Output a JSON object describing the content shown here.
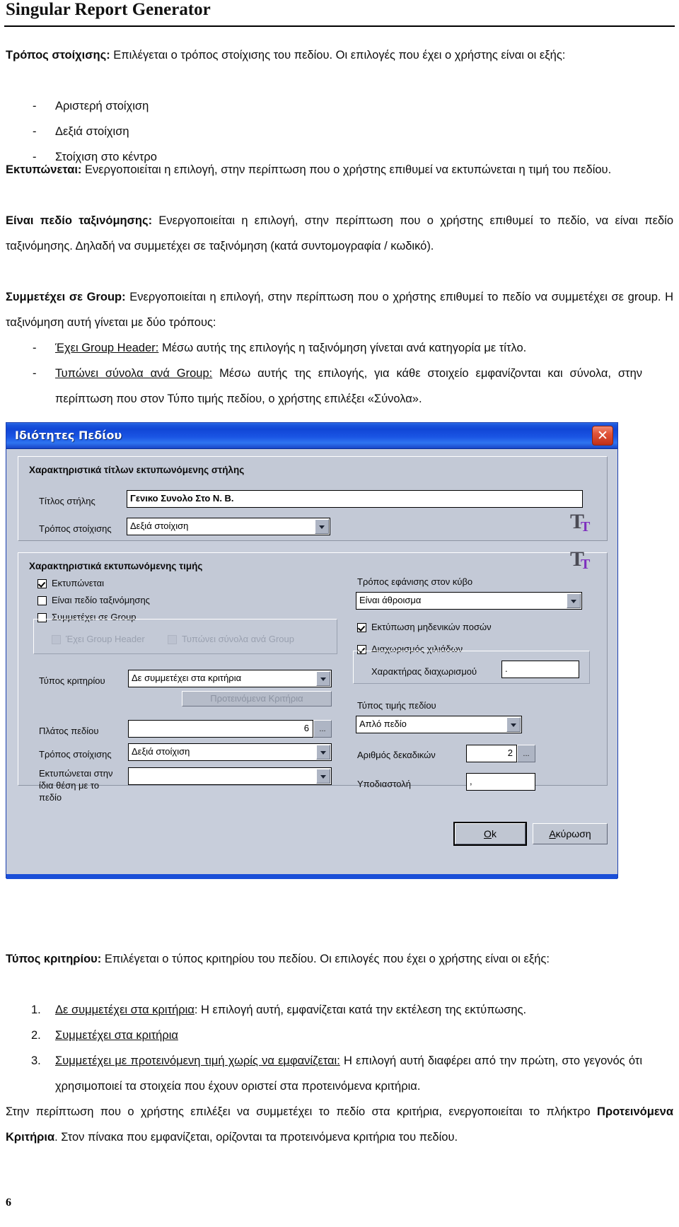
{
  "header": {
    "title": "Singular Report Generator"
  },
  "page_number": "6",
  "content": {
    "para_alignment": {
      "bold_lead": "Τρόπος στοίχισης:",
      "rest": " Επιλέγεται ο τρόπος στοίχισης του πεδίου. Οι επιλογές που έχει ο χρήστης είναι οι εξής:"
    },
    "alignment_options": [
      "Αριστερή στοίχιση",
      "Δεξιά στοίχιση",
      "Στοίχιση στο κέντρο"
    ],
    "para_print": {
      "bold_lead": "Εκτυπώνεται:",
      "rest": " Ενεργοποιείται η επιλογή, στην περίπτωση που ο χρήστης επιθυμεί να εκτυπώνεται η τιμή του πεδίου."
    },
    "para_sortfield": {
      "bold_lead": "Είναι πεδίο ταξινόμησης:",
      "rest": " Ενεργοποιείται η επιλογή, στην περίπτωση που ο χρήστης επιθυμεί το πεδίο, να είναι πεδίο ταξινόμησης. Δηλαδή να συμμετέχει σε ταξινόμηση (κατά συντομογραφία / κωδικό)."
    },
    "para_group": {
      "bold_lead": "Συμμετέχει σε Group:",
      "rest": " Ενεργοποιείται η επιλογή, στην περίπτωση που ο χρήστης επιθυμεί το πεδίο να συμμετέχει σε group. Η ταξινόμηση αυτή γίνεται με δύο τρόπους:"
    },
    "group_options": [
      {
        "underlined": "Έχει Group Header:",
        "rest": " Μέσω αυτής της επιλογής η ταξινόμηση γίνεται ανά κατηγορία με τίτλο."
      },
      {
        "underlined": "Τυπώνει σύνολα ανά Group:",
        "rest": " Μέσω αυτής της επιλογής, για κάθε στοιχείο εμφανίζονται και σύνολα, στην περίπτωση που στον Τύπο τιμής πεδίου, ο χρήστης επιλέξει «Σύνολα»."
      }
    ],
    "para_criteria": {
      "bold_lead": "Τύπος κριτηρίου:",
      "rest": " Επιλέγεται ο τύπος κριτηρίου του πεδίου. Οι επιλογές που έχει ο χρήστης είναι οι εξής:"
    },
    "criteria_items": [
      {
        "num": "1.",
        "underlined": "Δε συμμετέχει στα κριτήρια",
        "rest": ": Η επιλογή αυτή, εμφανίζεται κατά την εκτέλεση της εκτύπωσης."
      },
      {
        "num": "2.",
        "underlined": "Συμμετέχει στα κριτήρια",
        "rest": ""
      },
      {
        "num": "3.",
        "underlined": "Συμμετέχει με προτεινόμενη τιμή χωρίς να εμφανίζεται:",
        "rest": " Η επιλογή αυτή διαφέρει από την πρώτη, στο γεγονός ότι χρησιμοποιεί τα στοιχεία που έχουν οριστεί στα προτεινόμενα κριτήρια."
      }
    ],
    "para_closing": {
      "part1": "Στην περίπτωση που ο χρήστης επιλέξει να συμμετέχει το πεδίο στα κριτήρια, ενεργοποιείται το πλήκτρο ",
      "bold": "Προτεινόμενα Κριτήρια",
      "part2": ". Στον πίνακα που εμφανίζεται, ορίζονται τα προτεινόμενα κριτήρια του πεδίου."
    }
  },
  "dialog": {
    "title": "Ιδιότητες Πεδίου",
    "close_label": "✕",
    "group_title_header": "Χαρακτηριστικά τίτλων εκτυπωνόμενης στήλης",
    "group_value_header": "Χαρακτηριστικά εκτυπωνόμενης τιμής",
    "fields": {
      "column_title_label": "Τίτλος στήλης",
      "column_title_value": "Γενικο Συνολο Στο Ν. Β.",
      "title_align_label": "Τρόπος στοίχισης",
      "title_align_value": "Δεξιά στοίχιση",
      "print_checkbox": "Εκτυπώνεται",
      "is_sort_checkbox": "Είναι πεδίο ταξινόμησης",
      "in_group_checkbox": "Συμμετέχει σε Group",
      "has_group_header_checkbox": "Έχει Group Header",
      "prints_totals_checkbox": "Τυπώνει σύνολα ανά Group",
      "criteria_type_label": "Τύπος κριτηρίου",
      "criteria_type_value": "Δε συμμετέχει στα κριτήρια",
      "suggested_criteria_button": "Προτεινόμενα Κριτήρια",
      "field_width_label": "Πλάτος πεδίου",
      "field_width_value": "6",
      "value_align_label": "Τρόπος στοίχισης",
      "value_align_value": "Δεξιά στοίχιση",
      "same_position_label": "Εκτυπώνεται στην ίδια θέση με το πεδίο",
      "same_position_value": "",
      "cube_display_label": "Τρόπος εφάνισης στον κύβο",
      "cube_display_value": "Είναι άθροισμα",
      "print_zero_checkbox": "Εκτύπωση μηδενικών ποσών",
      "thousands_sep_checkbox": "Διαχωρισμός χιλιάδων",
      "sep_char_label": "Χαρακτήρας διαχωρισμού",
      "sep_char_value": ".",
      "value_type_label": "Τύπος τιμής πεδίου",
      "value_type_value": "Απλό πεδίο",
      "decimals_label": "Αριθμός δεκαδικών",
      "decimals_value": "2",
      "decimal_point_label": "Υποδιαστολή",
      "decimal_point_value": ","
    },
    "buttons": {
      "ok_accel": "O",
      "ok_rest": "k",
      "cancel_accel": "Α",
      "cancel_rest": "κύρωση"
    },
    "dots_label": "...",
    "colors": {
      "titlebar": "#1b56dd",
      "dialog_face": "#c8cedb",
      "group_face": "#c3c9d6",
      "close_red": "#c12f17"
    }
  }
}
